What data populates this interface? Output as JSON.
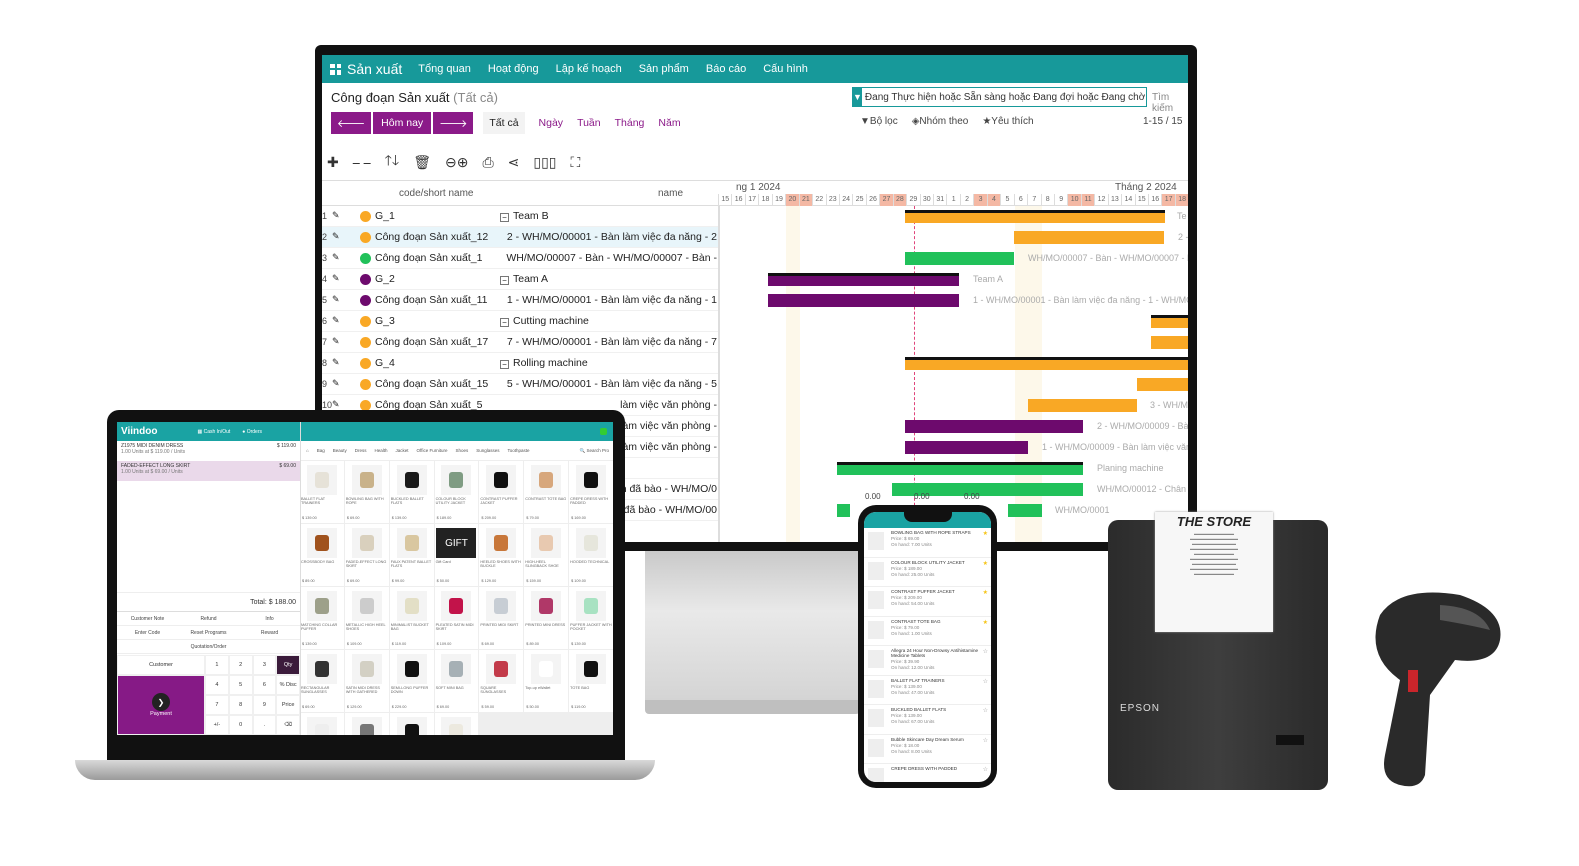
{
  "monitor": {
    "app_name": "Sản xuất",
    "menu": [
      "Tổng quan",
      "Hoạt động",
      "Lập kế hoạch",
      "Sản phẩm",
      "Báo cáo",
      "Cấu hình"
    ],
    "page_title": "Công đoạn Sản xuất",
    "page_title_suffix": "(Tất cả)",
    "filter_text": "Đang Thực hiện hoặc Sẵn sàng hoặc Đang đợi hoặc Đang chờ",
    "search_placeholder": "Tìm kiếm",
    "today_label": "Hôm nay",
    "period_tabs": [
      "Tất cả",
      "Ngày",
      "Tuần",
      "Tháng",
      "Năm"
    ],
    "filters_label": "Bộ lọc",
    "group_by_label": "Nhóm theo",
    "favorites_label": "Yêu thích",
    "pager": "1-15 / 15",
    "gantt": {
      "col_code": "code/short name",
      "col_name": "name",
      "month1": "ng 1 2024",
      "month2": "Tháng 2 2024",
      "days": [
        "15",
        "16",
        "17",
        "18",
        "19",
        "20",
        "21",
        "22",
        "23",
        "24",
        "25",
        "26",
        "27",
        "28",
        "29",
        "30",
        "31",
        "1",
        "2",
        "3",
        "4",
        "5",
        "6",
        "7",
        "8",
        "9",
        "10",
        "11",
        "12",
        "13",
        "14",
        "15",
        "16",
        "17",
        "18"
      ],
      "weekend_indexes": [
        5,
        6,
        12,
        13,
        19,
        20,
        26,
        27,
        33,
        34
      ],
      "rows": [
        {
          "n": "1",
          "code": "G_1",
          "name": "Team B",
          "group": true,
          "color": "#f9a825"
        },
        {
          "n": "2",
          "code": "Công đoạn Sản xuất_12",
          "name": "2 - WH/MO/00001 - Bàn làm việc đa năng - 2",
          "color": "#f9a825",
          "selected": true
        },
        {
          "n": "3",
          "code": "Công đoạn Sản xuất_1",
          "name": "WH/MO/00007 - Bàn - WH/MO/00007 - Bàn -",
          "color": "#21c15a"
        },
        {
          "n": "4",
          "code": "G_2",
          "name": "Team A",
          "group": true,
          "color": "#6d0a6d"
        },
        {
          "n": "5",
          "code": "Công đoạn Sản xuất_11",
          "name": "1 - WH/MO/00001 - Bàn làm việc đa năng - 1",
          "color": "#6d0a6d"
        },
        {
          "n": "6",
          "code": "G_3",
          "name": "Cutting machine",
          "group": true,
          "color": "#f9a825"
        },
        {
          "n": "7",
          "code": "Công đoạn Sản xuất_17",
          "name": "7 - WH/MO/00001 - Bàn làm việc đa năng - 7",
          "color": "#f9a825"
        },
        {
          "n": "8",
          "code": "G_4",
          "name": "Rolling machine",
          "group": true,
          "color": "#f9a825"
        },
        {
          "n": "9",
          "code": "Công đoạn Sản xuất_15",
          "name": "5 - WH/MO/00001 - Bàn làm việc đa năng - 5",
          "color": "#f9a825"
        },
        {
          "n": "10",
          "code": "Công đoạn Sản xuất_5",
          "name": "làm việc văn phòng -",
          "color": "#f9a825"
        },
        {
          "n": "11",
          "code": "",
          "name": "làm việc văn phòng -",
          "color": ""
        },
        {
          "n": "12",
          "code": "",
          "name": "làm việc văn phòng -",
          "color": ""
        },
        {
          "n": "13",
          "code": "",
          "name": "",
          "color": ""
        },
        {
          "n": "14",
          "code": "",
          "name": "ản đã bào - WH/MO/0",
          "color": ""
        },
        {
          "n": "15",
          "code": "",
          "name": "đã bào - WH/MO/00",
          "color": ""
        }
      ],
      "bar_labels": [
        "Te",
        "2 -",
        "WH/MO/00007 - Bàn - WH/MO/00007 - Bàn",
        "Team A",
        "1 - WH/MO/00001 - Bàn làm việc đa năng - 1 - WH/MO/00",
        "3 - WH/M",
        "2 - WH/MO/00009 - Bàn",
        "1 - WH/MO/00009 - Bàn làm việc văn ph",
        "Planing machine",
        "WH/MO/00012 - Chân bà",
        "WH/MO/0001"
      ],
      "load_values": [
        "0.00",
        "0.00",
        "0.00"
      ],
      "colors": {
        "orange": "#f9a825",
        "green": "#21c15a",
        "purple": "#6d0a6d",
        "primary": "#8b1a89",
        "header": "#17999a"
      }
    }
  },
  "pos": {
    "logo": "Viindoo",
    "cash_label": "Cash In/Out",
    "orders_label": "Orders",
    "order_lines": [
      {
        "name": "Z1975 MIDI DENIM DRESS",
        "detail": "1.00 Units at $ 119.00 / Units",
        "price": "$ 119.00"
      },
      {
        "name": "FADED-EFFECT LONG SKIRT",
        "detail": "1.00 Units at $ 69.00 / Units",
        "price": "$ 69.00",
        "selected": true
      }
    ],
    "total": "Total: $ 188.00",
    "categories": [
      "Bag",
      "Beauty",
      "Dress",
      "Health",
      "Jacket",
      "Office Furniture",
      "Shoes",
      "Sunglasses",
      "Toothpaste"
    ],
    "search_placeholder": "Search Pro",
    "actions": [
      [
        "Customer Note",
        "Refund",
        "Info"
      ],
      [
        "Enter Code",
        "Reset Programs",
        "Reward"
      ],
      [
        "Quotation/Order"
      ]
    ],
    "customer_label": "Customer",
    "payment_label": "Payment",
    "keys": [
      "1",
      "2",
      "3",
      "Qty",
      "4",
      "5",
      "6",
      "% Disc",
      "7",
      "8",
      "9",
      "Price",
      "+/-",
      "0",
      ".",
      "⌫"
    ],
    "products": [
      {
        "name": "BALLET FLAT TRAINERS",
        "price": "$ 139.00",
        "color": "#e6e2d8"
      },
      {
        "name": "BOWLING BAG WITH ROPE",
        "price": "$ 69.00",
        "color": "#c9b28a"
      },
      {
        "name": "BUCKLED BALLET FLATS",
        "price": "$ 139.00",
        "color": "#1a1a1a"
      },
      {
        "name": "COLOUR BLOCK UTILITY JACKET",
        "price": "$ 189.00",
        "color": "#7f9c83"
      },
      {
        "name": "CONTRAST PUFFER JACKET",
        "price": "$ 209.00",
        "color": "#111"
      },
      {
        "name": "CONTRAST TOTE BAG",
        "price": "$ 79.00",
        "color": "#d7a77c"
      },
      {
        "name": "CREPE DRESS WITH PADDED",
        "price": "$ 169.00",
        "color": "#111"
      },
      {
        "name": "CROSSBODY BAG",
        "price": "$ 89.00",
        "color": "#a0521d"
      },
      {
        "name": "FADED-EFFECT LONG SKIRT",
        "price": "$ 69.00",
        "color": "#d9d0bd"
      },
      {
        "name": "FAUX PATENT BALLET FLATS",
        "price": "$ 99.00",
        "color": "#d9c7a0"
      },
      {
        "name": "Gift Card",
        "price": "$ 50.00",
        "color": "#222",
        "gift": "GIFT"
      },
      {
        "name": "HEELED SHOES WITH BUCKLE",
        "price": "$ 129.00",
        "color": "#c8773a"
      },
      {
        "name": "HIGH-HEEL SLINGBACK SHOE",
        "price": "$ 159.00",
        "color": "#e8c9b0"
      },
      {
        "name": "HOODED TECHNICAL",
        "price": "$ 109.00",
        "color": "#e6e6dc"
      },
      {
        "name": "MATCHING COLLAR PUFFER",
        "price": "$ 139.00",
        "color": "#9da08a"
      },
      {
        "name": "METALLIC HIGH HEEL SHOES",
        "price": "$ 109.00",
        "color": "#ccc"
      },
      {
        "name": "MINIMALIST BUCKET BAG",
        "price": "$ 119.00",
        "color": "#e3dfc6"
      },
      {
        "name": "PLEATED SATIN MIDI SKIRT",
        "price": "$ 109.00",
        "color": "#c2134a"
      },
      {
        "name": "PRINTED MIDI SKIRT",
        "price": "$ 69.00",
        "color": "#c7cdd4"
      },
      {
        "name": "PRINTED MINI DRESS",
        "price": "$ 89.00",
        "color": "#b03868"
      },
      {
        "name": "PUFFER JACKET WITH POCKET",
        "price": "$ 139.00",
        "color": "#a8e2c2"
      },
      {
        "name": "RECTANGULAR SUNGLASSES",
        "price": "$ 69.00",
        "color": "#333"
      },
      {
        "name": "SATIN MIDI DRESS WITH GATHERED",
        "price": "$ 129.00",
        "color": "#d3d0c4"
      },
      {
        "name": "SEMI-LONG PUFFER DOWN",
        "price": "$ 229.00",
        "color": "#111"
      },
      {
        "name": "SOFT MINI BAG",
        "price": "$ 69.00",
        "color": "#a6b0b5"
      },
      {
        "name": "SQUARE SUNGLASSES",
        "price": "$ 59.00",
        "color": "#c33b4a"
      },
      {
        "name": "Top-up eWallet",
        "price": "$ 50.00",
        "color": "#fff"
      },
      {
        "name": "TOTE BAG",
        "price": "$ 119.00",
        "color": "#111"
      },
      {
        "name": "",
        "price": "",
        "color": "#eee"
      },
      {
        "name": "",
        "price": "",
        "color": "#777"
      },
      {
        "name": "",
        "price": "",
        "color": "#111"
      },
      {
        "name": "",
        "price": "",
        "color": "#ece9df"
      }
    ]
  },
  "phone": {
    "items": [
      {
        "name": "BOWLING BAG WITH ROPE STRAPS",
        "price": "Price: $ 69.00",
        "onhand": "On hand: 7.00 Units",
        "fav": true
      },
      {
        "name": "COLOUR BLOCK UTILITY JACKET",
        "price": "Price: $ 189.00",
        "onhand": "On hand: 25.00 Units",
        "fav": true
      },
      {
        "name": "CONTRAST PUFFER JACKET",
        "price": "Price: $ 209.00",
        "onhand": "On hand: 54.00 Units",
        "fav": true
      },
      {
        "name": "CONTRAST TOTE BAG",
        "price": "Price: $ 79.00",
        "onhand": "On hand: 1.00 Units",
        "fav": true
      },
      {
        "name": "Allegra 24 Hour Non-Drowsy Antihistamine Medicine Tablets",
        "price": "Price: $ 39.90",
        "onhand": "On hand: 12.00 Units",
        "fav": false
      },
      {
        "name": "BALLET FLAT TRAINERS",
        "price": "Price: $ 139.00",
        "onhand": "On hand: 47.00 Units",
        "fav": false
      },
      {
        "name": "BUCKLED BALLET FLATS",
        "price": "Price: $ 139.00",
        "onhand": "On hand: 67.00 Units",
        "fav": false
      },
      {
        "name": "Bubble Skincare Day Dream Serum",
        "price": "Price: $ 18.00",
        "onhand": "On hand: 8.00 Units",
        "fav": false
      },
      {
        "name": "CREPE DRESS WITH PADDED",
        "price": "",
        "onhand": "",
        "fav": false
      }
    ]
  },
  "printer": {
    "receipt_title": "THE STORE",
    "brand": "EPSON"
  }
}
